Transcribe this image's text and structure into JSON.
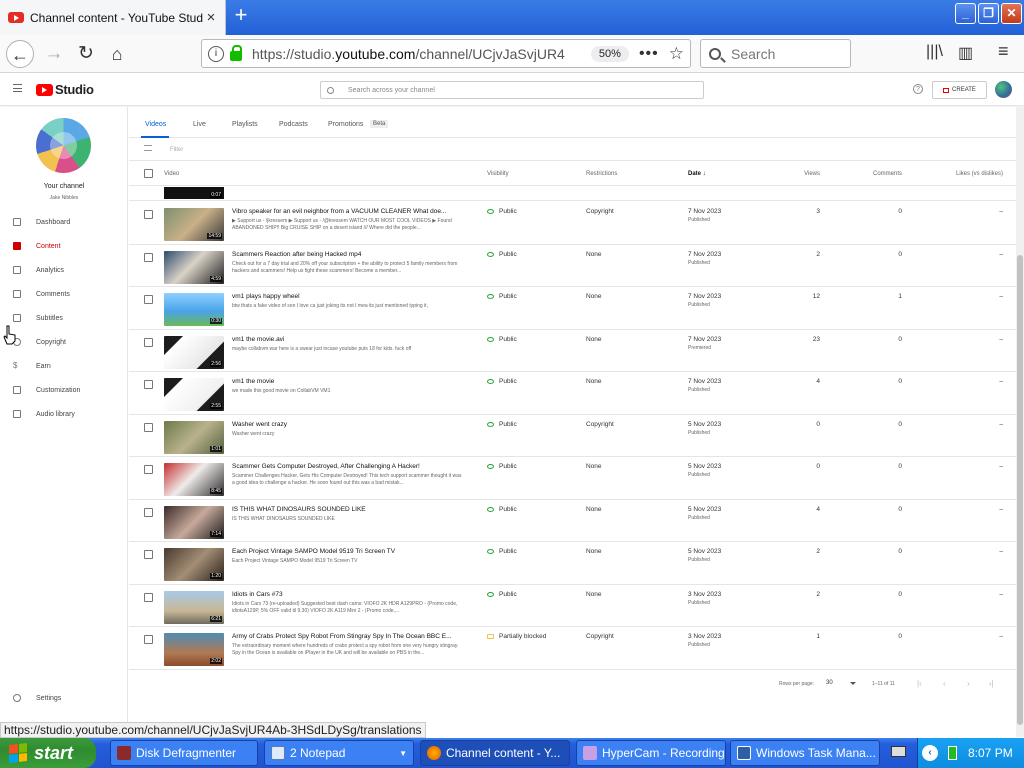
{
  "browser": {
    "tab_title": "Channel content - YouTube Studio",
    "tab_close": "×",
    "new_tab": "+",
    "url_prefix": "https://studio.",
    "url_domain": "youtube.com",
    "url_rest": "/channel/UCjvJaSvjUR4",
    "zoom": "50%",
    "search_placeholder": "Search",
    "status_url": "https://studio.youtube.com/channel/UCjvJaSvjUR4Ab-3HSdLDySg/translations"
  },
  "studio": {
    "logo_text": "Studio",
    "search_placeholder": "Search across your channel",
    "create_label": "CREATE",
    "help": "?"
  },
  "sidebar": {
    "your_channel": "Your channel",
    "channel_name": "Jake Nibbles",
    "items": [
      {
        "label": "Dashboard",
        "icon": "dashboard-icon"
      },
      {
        "label": "Content",
        "icon": "content-icon"
      },
      {
        "label": "Analytics",
        "icon": "analytics-icon"
      },
      {
        "label": "Comments",
        "icon": "comments-icon"
      },
      {
        "label": "Subtitles",
        "icon": "subtitles-icon"
      },
      {
        "label": "Copyright",
        "icon": "copyright-icon"
      },
      {
        "label": "Earn",
        "icon": "earn-icon"
      },
      {
        "label": "Customization",
        "icon": "customization-icon"
      },
      {
        "label": "Audio library",
        "icon": "audio-library-icon"
      },
      {
        "label": "Settings",
        "icon": "settings-icon"
      }
    ]
  },
  "tabs": [
    {
      "label": "Videos"
    },
    {
      "label": "Live"
    },
    {
      "label": "Playlists"
    },
    {
      "label": "Podcasts"
    },
    {
      "label": "Promotions"
    }
  ],
  "beta": "Beta",
  "filter_placeholder": "Filter",
  "columns": {
    "video": "Video",
    "visibility": "Visibility",
    "restrictions": "Restrictions",
    "date": "Date ↓",
    "views": "Views",
    "comments": "Comments",
    "likes": "Likes (vs dislikes)"
  },
  "partial_duration": "0:07",
  "rows": [
    {
      "title": "Vibro speaker for an evil neighbor from a VACUUM CLEANER What doe...",
      "desc": "▶ Support us - /jkressem ▶ Support us - /@kressem WATCH OUR MOST COOL VIDEOS ▶ Found ABANDONED SHIP!! Big CRUISE SHIP on a desert island /// Where did the people...",
      "duration": "14:59",
      "visibility": "Public",
      "restrictions": "Copyright",
      "date": "7 Nov 2023",
      "date_sub": "Published",
      "views": "3",
      "comments": "0",
      "likes": "–"
    },
    {
      "title": "Scammers Reaction after being Hacked mp4",
      "desc": "Check out for a 7 day trial and 20% off your subscription + the ability to protect 5 family members from hackers and scammers! Help us fight these scammers! Become a member...",
      "duration": "4:59",
      "visibility": "Public",
      "restrictions": "None",
      "date": "7 Nov 2023",
      "date_sub": "Published",
      "views": "2",
      "comments": "0",
      "likes": "–"
    },
    {
      "title": "vm1 plays happy wheel",
      "desc": "btw thats a fake video of son I love ca just joking its not I mea its just mentioned typing it,",
      "duration": "0:30",
      "visibility": "Public",
      "restrictions": "None",
      "date": "7 Nov 2023",
      "date_sub": "Published",
      "views": "12",
      "comments": "1",
      "likes": "–"
    },
    {
      "title": "vm1 the movie.avi",
      "desc": "maybe collabvm war here is a swear just incase youtube puts 18 for kids. fuck off",
      "duration": "2:56",
      "visibility": "Public",
      "restrictions": "None",
      "date": "7 Nov 2023",
      "date_sub": "Premiered",
      "views": "23",
      "comments": "0",
      "likes": "–"
    },
    {
      "title": "vm1 the movie",
      "desc": "we made this good movie on CollabVM VM1",
      "duration": "2:55",
      "visibility": "Public",
      "restrictions": "None",
      "date": "7 Nov 2023",
      "date_sub": "Published",
      "views": "4",
      "comments": "0",
      "likes": "–"
    },
    {
      "title": "Washer went crazy",
      "desc": "Washer went crazy",
      "duration": "1:01",
      "visibility": "Public",
      "restrictions": "Copyright",
      "date": "5 Nov 2023",
      "date_sub": "Published",
      "views": "0",
      "comments": "0",
      "likes": "–"
    },
    {
      "title": "Scammer Gets Computer Destroyed, After Challenging A Hacker!",
      "desc": "Scammer Challenges Hacker, Gets His Computer Destroyed! This tech support scammer thought it was a good idea to challenge a hacker. He soon found out this was a bad mistak...",
      "duration": "8:45",
      "visibility": "Public",
      "restrictions": "None",
      "date": "5 Nov 2023",
      "date_sub": "Published",
      "views": "0",
      "comments": "0",
      "likes": "–"
    },
    {
      "title": "IS THIS WHAT DINOSAURS SOUNDED LIKE",
      "desc": "IS THIS WHAT DINOSAURS SOUNDED LIKE",
      "duration": "7:14",
      "visibility": "Public",
      "restrictions": "None",
      "date": "5 Nov 2023",
      "date_sub": "Published",
      "views": "4",
      "comments": "0",
      "likes": "–"
    },
    {
      "title": "Each Project Vintage SAMPO Model 9519 Tri Screen TV",
      "desc": "Each Project Vintage SAMPO Model 9519 Tri Screen TV",
      "duration": "1:20",
      "visibility": "Public",
      "restrictions": "None",
      "date": "5 Nov 2023",
      "date_sub": "Published",
      "views": "2",
      "comments": "0",
      "likes": "–"
    },
    {
      "title": "Idiots in Cars #73",
      "desc": "Idiots in Cars 73 (re-uploaded) Suggested best dash cams: VIOFO 2K HDR A129PRO - (Promo code, idiotsA129P, 5% OFF valid til 9.30) VIOFO 2K A119 Mini 2 - (Promo code,...",
      "duration": "6:21",
      "visibility": "Public",
      "restrictions": "None",
      "date": "3 Nov 2023",
      "date_sub": "Published",
      "views": "2",
      "comments": "0",
      "likes": "–"
    },
    {
      "title": "Army of Crabs Protect Spy Robot From Stingray Spy In The Ocean BBC E...",
      "desc": "The extraordinary moment where hundreds of crabs protect a spy robot from one very hungry stingray. Spy in the Ocean is available on iPlayer in the UK and will be available on PBS in the...",
      "duration": "2:02",
      "visibility": "Partially blocked",
      "restrictions": "Copyright",
      "date": "3 Nov 2023",
      "date_sub": "Published",
      "views": "1",
      "comments": "0",
      "likes": "–"
    }
  ],
  "pager": {
    "rows_per_page_label": "Rows per page:",
    "rows_per_page": "30",
    "range": "1–11 of 11"
  },
  "taskbar": {
    "start": "start",
    "tasks": [
      {
        "label": "Disk Defragmenter"
      },
      {
        "label": "2 Notepad"
      },
      {
        "label": "Channel content - Y..."
      },
      {
        "label": "HyperCam - Recording"
      },
      {
        "label": "Windows Task Mana..."
      }
    ],
    "clock": "8:07 PM"
  }
}
